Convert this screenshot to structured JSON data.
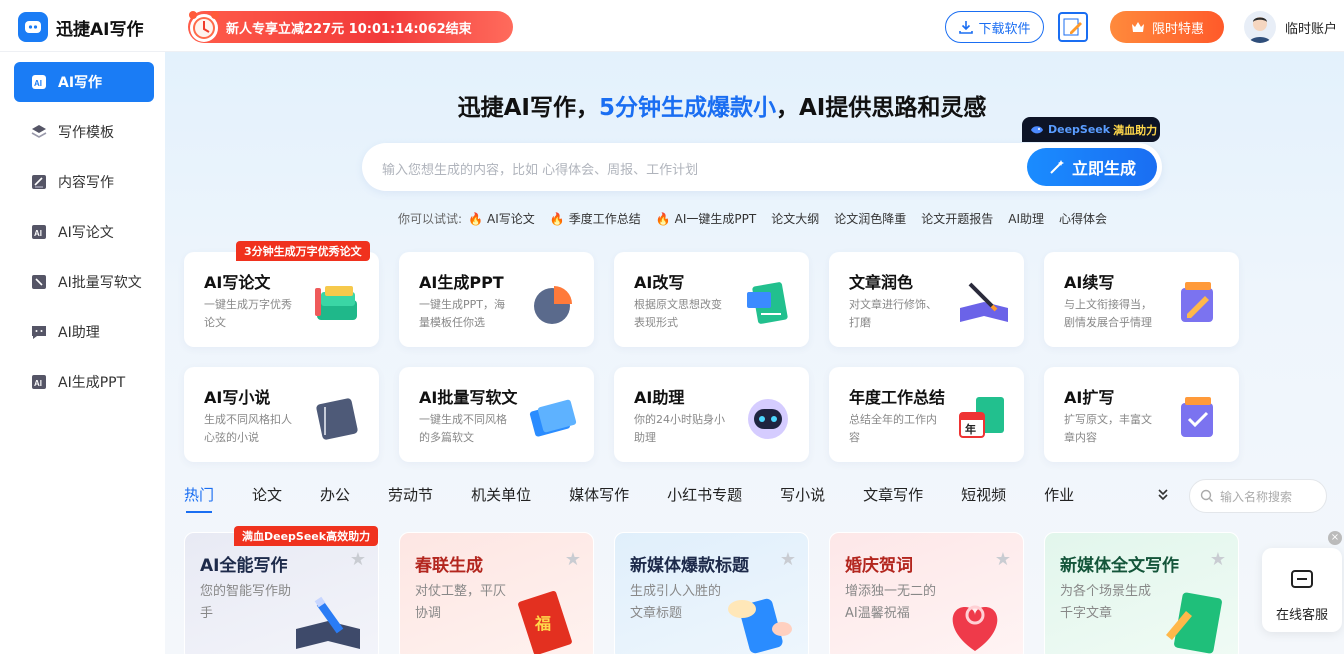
{
  "app": {
    "name": "迅捷AI写作"
  },
  "promo": {
    "text": "新人专享立减227元  10:01:14:062结束"
  },
  "header": {
    "download_label": "下载软件",
    "sale_label": "限时特惠",
    "account_label": "临时账户"
  },
  "sidebar": {
    "items": [
      {
        "label": "AI写作",
        "icon": "ai-write-icon"
      },
      {
        "label": "写作模板",
        "icon": "template-icon"
      },
      {
        "label": "内容写作",
        "icon": "content-write-icon"
      },
      {
        "label": "AI写论文",
        "icon": "paper-icon"
      },
      {
        "label": "AI批量写软文",
        "icon": "batch-write-icon"
      },
      {
        "label": "AI助理",
        "icon": "assistant-icon"
      },
      {
        "label": "AI生成PPT",
        "icon": "ppt-icon"
      }
    ]
  },
  "hero": {
    "title_pre": "迅捷AI写作，",
    "title_highlight": "5分钟生成爆款小",
    "title_post": "，AI提供思路和灵感",
    "placeholder": "输入您想生成的内容，比如 心得体会、周报、工作计划",
    "generate_label": "立即生成",
    "ds_badge_a": "DeepSeek",
    "ds_badge_b": "满血助力"
  },
  "tries": {
    "label": "你可以试试:",
    "items": [
      "AI写论文",
      "季度工作总结",
      "AI一键生成PPT",
      "论文大纲",
      "论文润色降重",
      "论文开题报告",
      "AI助理",
      "心得体会"
    ]
  },
  "feature_badge": "3分钟生成万字优秀论文",
  "features": [
    {
      "title": "AI写论文",
      "desc": "一键生成万字优秀论文"
    },
    {
      "title": "AI生成PPT",
      "desc": "一键生成PPT，海量模板任你选"
    },
    {
      "title": "AI改写",
      "desc": "根据原文思想改变表现形式"
    },
    {
      "title": "文章润色",
      "desc": "对文章进行修饰、打磨"
    },
    {
      "title": "AI续写",
      "desc": "与上文衔接得当，剧情发展合乎情理"
    },
    {
      "title": "AI写小说",
      "desc": "生成不同风格扣人心弦的小说"
    },
    {
      "title": "AI批量写软文",
      "desc": "一键生成不同风格的多篇软文"
    },
    {
      "title": "AI助理",
      "desc": "你的24小时贴身小助理"
    },
    {
      "title": "年度工作总结",
      "desc": "总结全年的工作内容"
    },
    {
      "title": "AI扩写",
      "desc": "扩写原文，丰富文章内容"
    }
  ],
  "tabs": [
    "热门",
    "论文",
    "办公",
    "劳动节",
    "机关单位",
    "媒体写作",
    "小红书专题",
    "写小说",
    "文章写作",
    "短视频",
    "作业"
  ],
  "tab_search_placeholder": "输入名称搜索",
  "template_badge": "满血DeepSeek高效助力",
  "templates": [
    {
      "title": "AI全能写作",
      "desc": "您的智能写作助手",
      "color": "#1d2a4a"
    },
    {
      "title": "春联生成",
      "desc": "对仗工整，平仄协调",
      "color": "#b3261e"
    },
    {
      "title": "新媒体爆款标题",
      "desc": "生成引人入胜的文章标题",
      "color": "#1d2a4a"
    },
    {
      "title": "婚庆贺词",
      "desc": "增添独一无二的AI温馨祝福",
      "color": "#b3261e"
    },
    {
      "title": "新媒体全文写作",
      "desc": "为各个场景生成千字文章",
      "color": "#14553a"
    }
  ],
  "service": {
    "label": "在线客服"
  }
}
